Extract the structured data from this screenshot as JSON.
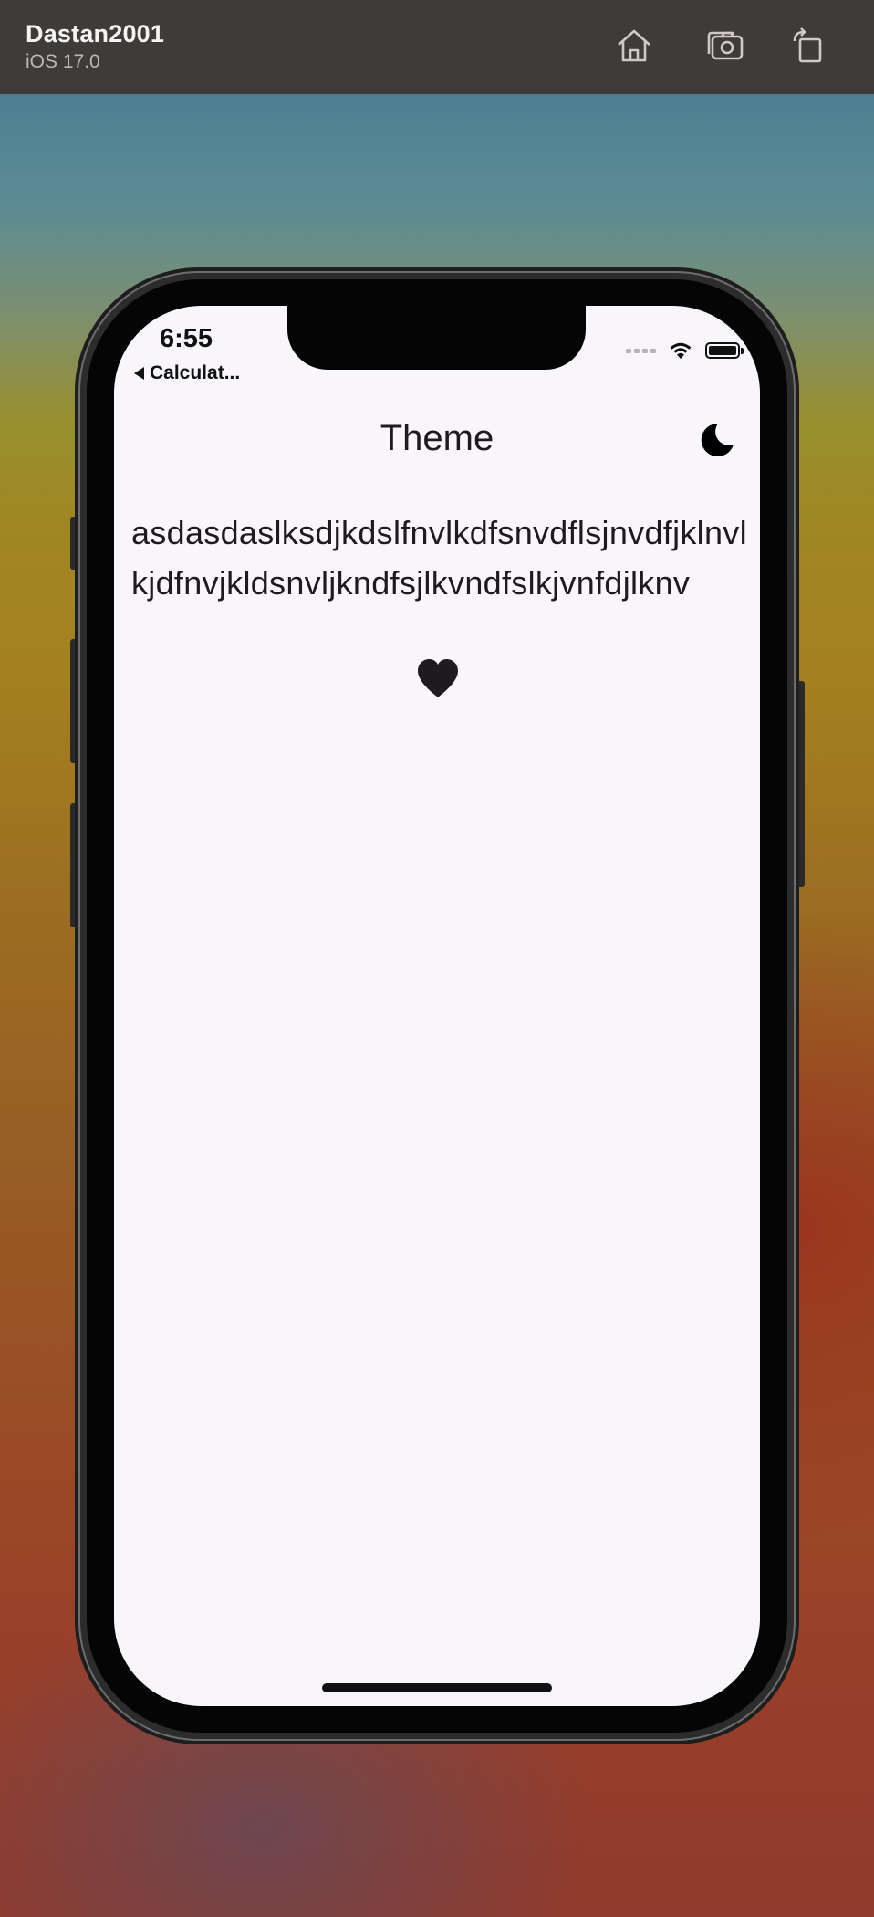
{
  "simulator": {
    "device_name": "Dastan2001",
    "os_version": "iOS 17.0",
    "toolbar_icons": [
      "home-icon",
      "screenshot-icon",
      "rotate-icon"
    ]
  },
  "status_bar": {
    "time": "6:55",
    "back_app_label": "Calculat...",
    "icons": [
      "cellular-signal-icon",
      "wifi-icon",
      "battery-icon"
    ]
  },
  "app": {
    "title": "Theme",
    "theme_toggle_icon": "moon-icon",
    "body_text": "asdasdaslksdjkdslfnvlkdfsnvdflsjnvdfjklnvlkjdfnvjkldsnvljkndfsjlkvndfslkjvnfdjlknv",
    "heart_icon": "heart-icon"
  },
  "colors": {
    "screen_background": "#f9f6fb",
    "text": "#1d1b20",
    "toolbar_background": "#3f3b39"
  }
}
